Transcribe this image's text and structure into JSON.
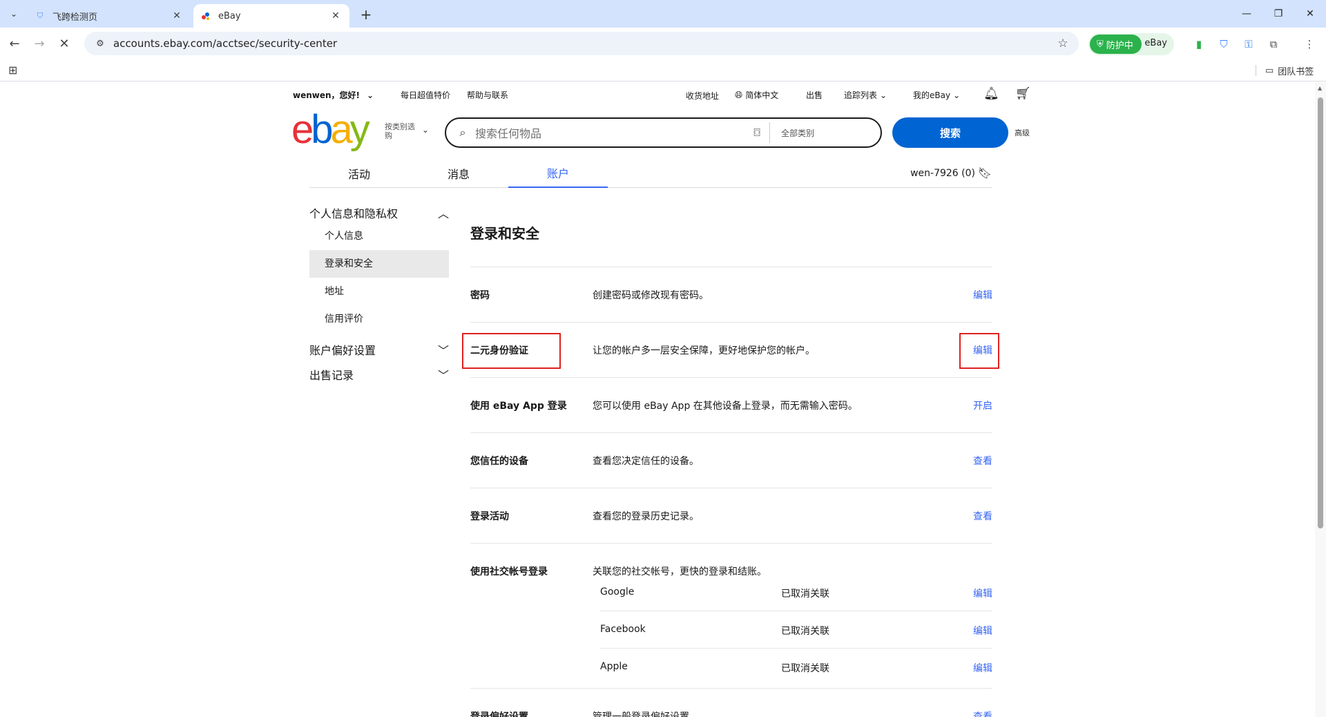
{
  "browser": {
    "tabs": [
      {
        "title": "飞跨检测页",
        "close": "✕"
      },
      {
        "title": "eBay",
        "close": "✕"
      }
    ],
    "new_tab": "+",
    "url": "accounts.ebay.com/acctsec/security-center",
    "protect_label": "防护中",
    "protect_site": "eBay",
    "bookmark_folder": "团队书签",
    "window_controls": {
      "minimize": "—",
      "restore": "❐",
      "close": "✕"
    }
  },
  "header": {
    "greeting": "wenwen，您好!",
    "deals": "每日超值特价",
    "help": "帮助与联系",
    "ship_to": "收货地址",
    "language": "简体中文",
    "sell": "出售",
    "watchlist": "追踪列表",
    "my_ebay": "我的eBay",
    "shop_by_category": "按类别选购",
    "search_placeholder": "搜索任何物品",
    "category_select": "全部类别",
    "search_button": "搜索",
    "advanced": "高级"
  },
  "logo": {
    "e": "e",
    "b": "b",
    "a": "a",
    "y": "y"
  },
  "tabs": {
    "activity": "活动",
    "messages": "消息",
    "account": "账户",
    "user_id": "wen-7926 (0)"
  },
  "sidebar": {
    "group1": "个人信息和隐私权",
    "items": [
      "个人信息",
      "登录和安全",
      "地址",
      "信用评价"
    ],
    "group2": "账户偏好设置",
    "group3": "出售记录"
  },
  "content": {
    "title": "登录和安全",
    "rows": [
      {
        "label": "密码",
        "desc": "创建密码或修改现有密码。",
        "action": "编辑"
      },
      {
        "label": "二元身份验证",
        "desc": "让您的帐户多一层安全保障，更好地保护您的帐户。",
        "action": "编辑"
      },
      {
        "label": "使用 eBay App 登录",
        "desc": "您可以使用 eBay App 在其他设备上登录，而无需输入密码。",
        "action": "开启"
      },
      {
        "label": "您信任的设备",
        "desc": "查看您决定信任的设备。",
        "action": "查看"
      },
      {
        "label": "登录活动",
        "desc": "查看您的登录历史记录。",
        "action": "查看"
      },
      {
        "label": "使用社交帐号登录",
        "desc": "关联您的社交帐号，更快的登录和结账。",
        "action": ""
      },
      {
        "label": "登录偏好设置",
        "desc": "管理一般登录偏好设置。",
        "action": "查看"
      }
    ],
    "social": [
      {
        "name": "Google",
        "status": "已取消关联",
        "action": "编辑"
      },
      {
        "name": "Facebook",
        "status": "已取消关联",
        "action": "编辑"
      },
      {
        "name": "Apple",
        "status": "已取消关联",
        "action": "编辑"
      }
    ]
  },
  "colors": {
    "accent": "#3665f3",
    "search_button": "#0064d2",
    "highlight": "#e02020",
    "protect": "#2bb24c"
  }
}
